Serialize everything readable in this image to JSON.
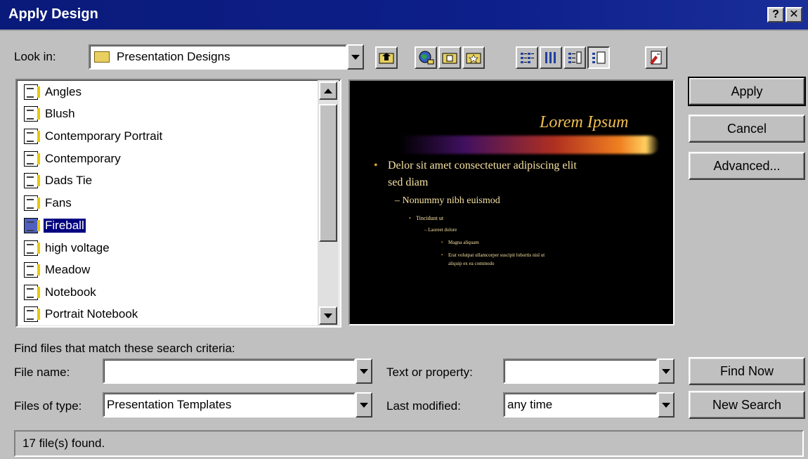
{
  "window": {
    "title": "Apply Design",
    "help_label": "?",
    "close_label": "✕"
  },
  "look_in": {
    "label": "Look in:",
    "value": "Presentation Designs"
  },
  "files": [
    {
      "name": "Angles"
    },
    {
      "name": "Blush"
    },
    {
      "name": "Contemporary Portrait"
    },
    {
      "name": "Contemporary"
    },
    {
      "name": "Dads Tie"
    },
    {
      "name": "Fans"
    },
    {
      "name": "Fireball",
      "selected": true
    },
    {
      "name": "high voltage"
    },
    {
      "name": "Meadow"
    },
    {
      "name": "Notebook"
    },
    {
      "name": "Portrait Notebook"
    }
  ],
  "preview": {
    "title": "Lorem Ipsum",
    "bullet1": "Delor sit amet consectetuer adipiscing elit",
    "bullet1b": "sed diam",
    "bullet2": "– Nonummy nibh euismod",
    "bullet3": "Tincidunt ut",
    "bullet4": "– Laoreet dolore",
    "bullet5": "Magna aliquam",
    "bullet6": "Erat volutpat ullamcorper suscipit lobortis nisl ut",
    "bullet6b": "aliquip ex ea commodo"
  },
  "buttons": {
    "apply": "Apply",
    "cancel": "Cancel",
    "advanced": "Advanced...",
    "find_now": "Find Now",
    "new_search": "New Search"
  },
  "search": {
    "heading": "Find files that match these search criteria:",
    "file_name_label": "File name:",
    "file_name_value": "",
    "files_of_type_label": "Files of type:",
    "files_of_type_value": "Presentation Templates",
    "text_property_label": "Text or property:",
    "text_property_value": "",
    "last_modified_label": "Last modified:",
    "last_modified_value": "any time"
  },
  "status": "17 file(s) found."
}
